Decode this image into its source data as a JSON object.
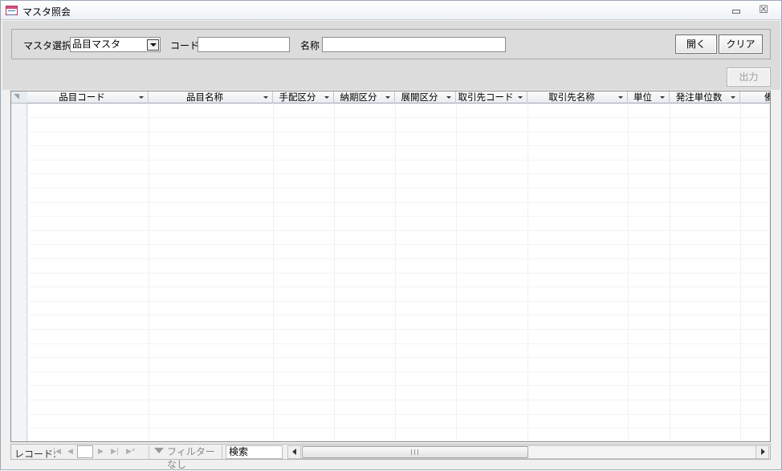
{
  "window": {
    "title": "マスタ照会"
  },
  "filters": {
    "master_label": "マスタ選択",
    "master_value": "品目マスタ",
    "code_label": "コード",
    "code_value": "",
    "name_label": "名称",
    "name_value": ""
  },
  "buttons": {
    "open": "開く",
    "clear": "クリア",
    "output": "出力"
  },
  "grid": {
    "columns": [
      "品目コード",
      "品目名称",
      "手配区分",
      "納期区分",
      "展開区分",
      "取引先コード",
      "取引先名称",
      "単位",
      "発注単位数",
      "備"
    ]
  },
  "statusbar": {
    "record_label": "レコード:",
    "no_filter": "フィルターなし",
    "search": "検索"
  }
}
